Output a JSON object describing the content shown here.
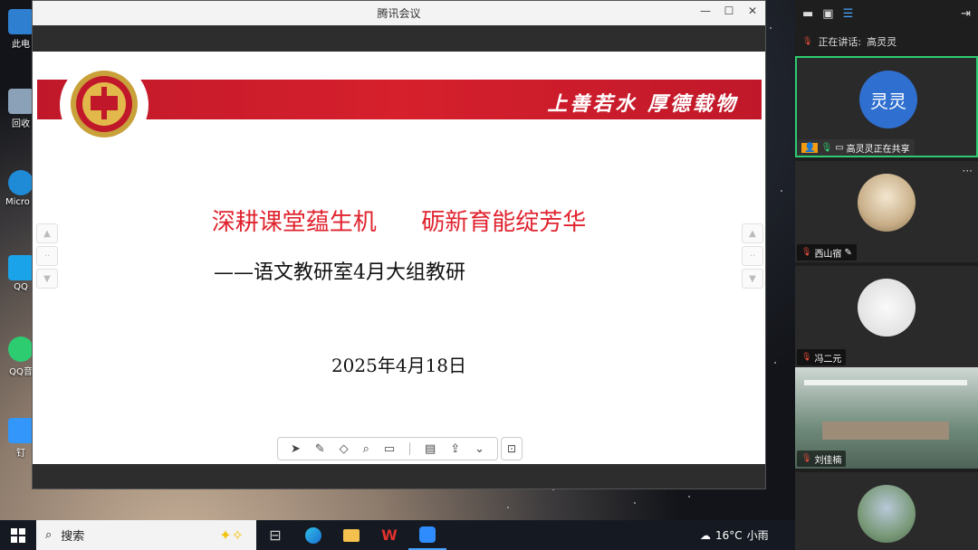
{
  "window": {
    "title": "腾讯会议",
    "controls": [
      "—",
      "☐",
      "✕"
    ]
  },
  "slide": {
    "motto": "上善若水  厚德载物",
    "title": "深耕课堂蕴生机      砺新育能绽芳华",
    "subtitle": "——语文教研室4月大组教研",
    "date": "2025年4月18日"
  },
  "desktop_icons": [
    {
      "label": "此电",
      "color": "#2f7fd1"
    },
    {
      "label": "回收",
      "color": "#8aa1b8"
    },
    {
      "label": "Micro Edg",
      "color": "#1f8bd6"
    },
    {
      "label": "QQ",
      "color": "#1aa3e8"
    },
    {
      "label": "QQ音",
      "color": "#2ecc71"
    },
    {
      "label": "钉",
      "color": "#3296fa"
    }
  ],
  "panel": {
    "speaking_label": "正在讲话:",
    "speaking_name": "高灵灵",
    "participants": [
      {
        "name": "高灵灵正在共享",
        "avatar_text": "灵灵",
        "avatar_color": "#2f6fd0",
        "active": true
      },
      {
        "name": "西山宿",
        "avatar_text": "",
        "avatar_color": "#c9b08a",
        "active": false
      },
      {
        "name": "冯二元",
        "avatar_text": "",
        "avatar_color": "#d8d8d8",
        "active": false
      },
      {
        "name": "刘佳楠",
        "avatar_text": "",
        "avatar_color": "#6f8a7a",
        "active": false
      },
      {
        "name": "",
        "avatar_text": "",
        "avatar_color": "#7a9a7a",
        "active": false
      }
    ]
  },
  "taskbar": {
    "search_placeholder": "搜索",
    "weather_temp": "16°C",
    "weather_desc": "小雨"
  },
  "colors": {
    "accent_red": "#d6202c",
    "active_green": "#2ecc71"
  }
}
